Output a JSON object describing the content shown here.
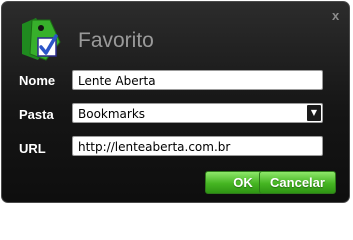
{
  "dialog": {
    "title": "Favorito",
    "close_label": "x"
  },
  "form": {
    "name_label": "Nome",
    "name_value": "Lente Aberta",
    "folder_label": "Pasta",
    "folder_value": "Bookmarks",
    "url_label": "URL",
    "url_value": "http://lenteaberta.com.br"
  },
  "buttons": {
    "ok_label": "OK",
    "cancel_label": "Cancelar"
  },
  "colors": {
    "accent": "#45b522",
    "background": "#151515"
  },
  "icons": {
    "logo": "bookmark-tag-check-icon",
    "dropdown": "triangle-down-icon"
  }
}
